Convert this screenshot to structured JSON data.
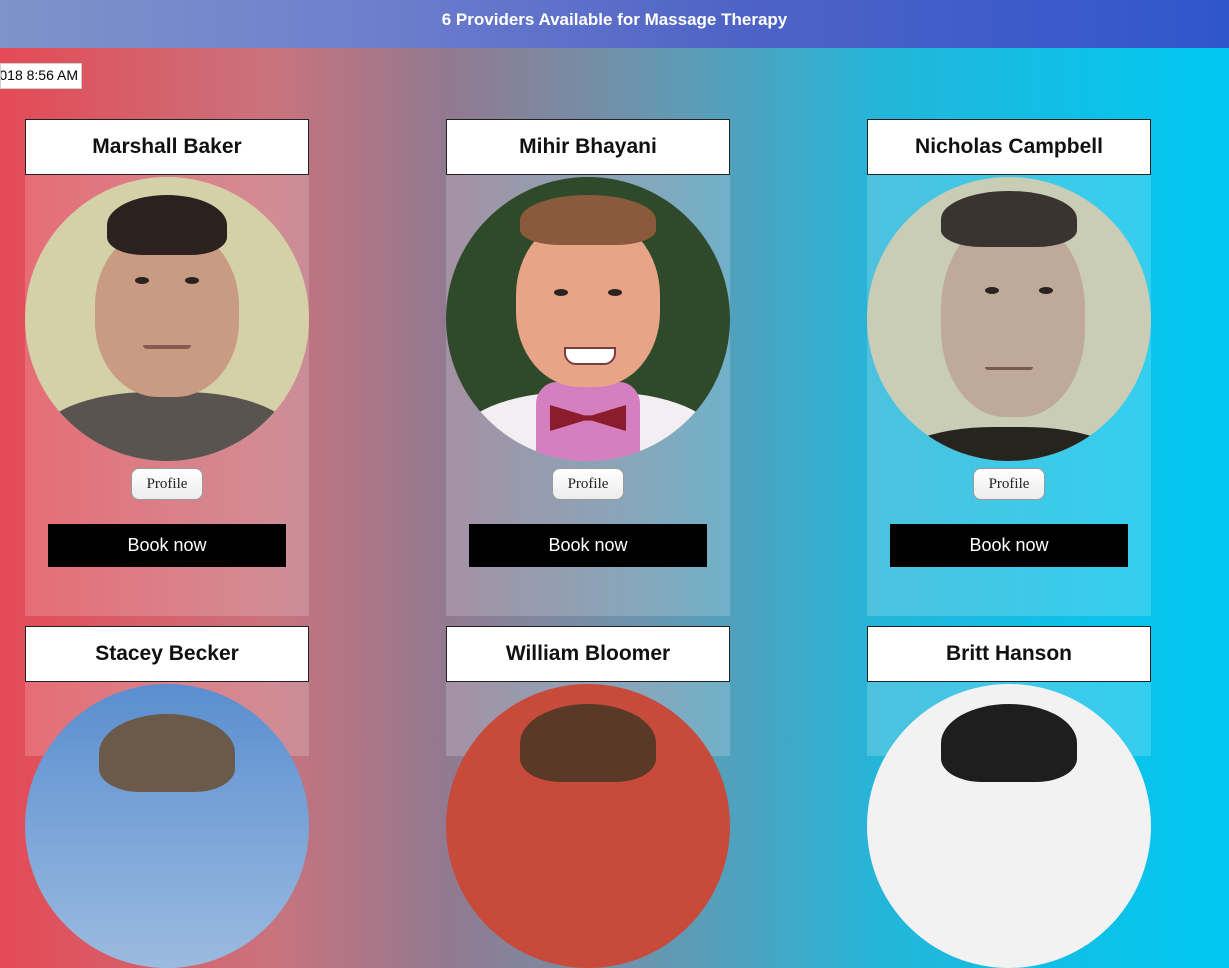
{
  "header": {
    "title": "6 Providers Available for Massage Therapy"
  },
  "timestamp": "018 8:56 AM",
  "providers": [
    {
      "name": "Marshall Baker",
      "profile_label": "Profile",
      "book_label": "Book now"
    },
    {
      "name": "Mihir Bhayani",
      "profile_label": "Profile",
      "book_label": "Book now"
    },
    {
      "name": "Nicholas Campbell",
      "profile_label": "Profile",
      "book_label": "Book now"
    },
    {
      "name": "Stacey Becker"
    },
    {
      "name": "William Bloomer"
    },
    {
      "name": "Britt Hanson"
    }
  ],
  "colors": {
    "gradient_left": "#e44a55",
    "gradient_right": "#00c8f2",
    "header_blue": "#3056cc",
    "book_button": "#000000"
  }
}
